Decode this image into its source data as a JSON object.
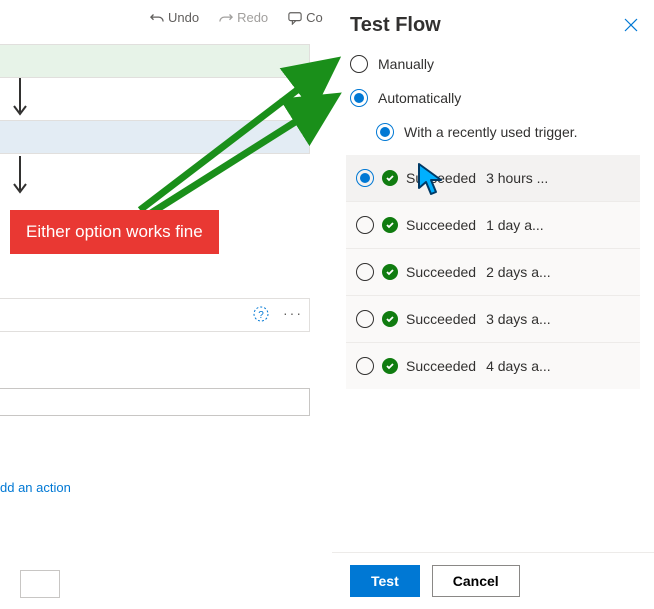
{
  "toolbar": {
    "undo": "Undo",
    "redo": "Redo",
    "comment": "Co"
  },
  "canvas": {
    "add_action": "dd an action"
  },
  "annotation": {
    "callout": "Either option works fine"
  },
  "panel": {
    "title": "Test Flow",
    "opt_manually": "Manually",
    "opt_automatically": "Automatically",
    "opt_recent_trigger": "With a recently used trigger.",
    "runs": [
      {
        "status": "Succeeded",
        "time": "3 hours ...",
        "selected": true
      },
      {
        "status": "Succeeded",
        "time": "1 day a...",
        "selected": false
      },
      {
        "status": "Succeeded",
        "time": "2 days a...",
        "selected": false
      },
      {
        "status": "Succeeded",
        "time": "3 days a...",
        "selected": false
      },
      {
        "status": "Succeeded",
        "time": "4 days a...",
        "selected": false
      }
    ],
    "btn_test": "Test",
    "btn_cancel": "Cancel"
  }
}
